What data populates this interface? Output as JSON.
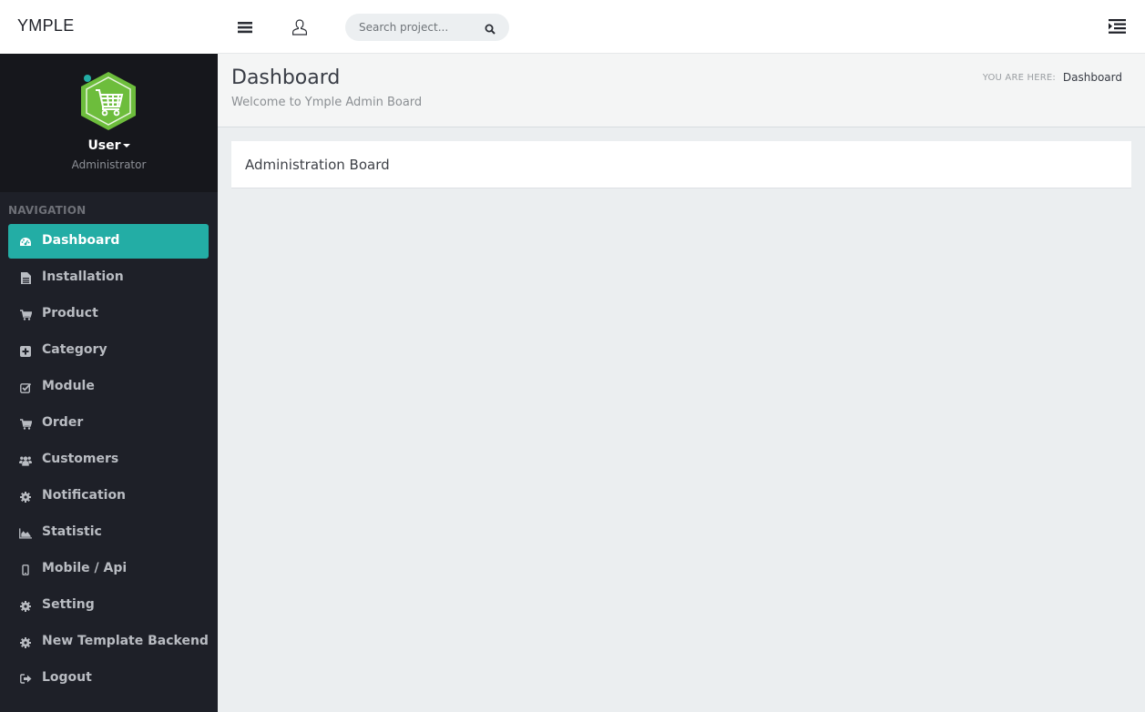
{
  "brand": {
    "name": "YMPLE"
  },
  "topbar": {
    "menu_icon": "bars-icon",
    "user_icon": "user-outline-icon",
    "search": {
      "placeholder": "Search project...",
      "value": "",
      "icon": "search-icon"
    },
    "right_toggle_icon": "indent-icon"
  },
  "profile": {
    "name": "User",
    "role": "Administrator",
    "status": "online",
    "avatar_icon": "shopping-cart-hexagon-logo"
  },
  "sidebar": {
    "section_title": "NAVIGATION",
    "items": [
      {
        "label": "Dashboard",
        "icon": "dashboard-icon",
        "active": true
      },
      {
        "label": "Installation",
        "icon": "file-text-icon",
        "active": false
      },
      {
        "label": "Product",
        "icon": "shopping-cart-icon",
        "active": false
      },
      {
        "label": "Category",
        "icon": "plus-square-icon",
        "active": false
      },
      {
        "label": "Module",
        "icon": "check-square-icon",
        "active": false
      },
      {
        "label": "Order",
        "icon": "shopping-cart-icon",
        "active": false
      },
      {
        "label": "Customers",
        "icon": "users-icon",
        "active": false
      },
      {
        "label": "Notification",
        "icon": "cog-icon",
        "active": false
      },
      {
        "label": "Statistic",
        "icon": "area-chart-icon",
        "active": false
      },
      {
        "label": "Mobile / Api",
        "icon": "mobile-icon",
        "active": false
      },
      {
        "label": "Setting",
        "icon": "cog-icon",
        "active": false
      },
      {
        "label": "New Template Backend",
        "icon": "cog-icon",
        "active": false
      },
      {
        "label": "Logout",
        "icon": "sign-out-icon",
        "active": false
      }
    ]
  },
  "header": {
    "title": "Dashboard",
    "subtitle": "Welcome to Ymple Admin Board",
    "breadcrumb_label": "YOU ARE HERE:",
    "breadcrumb_current": "Dashboard"
  },
  "panel": {
    "title": "Administration Board"
  },
  "colors": {
    "accent": "#23ada5",
    "sidebar_bg": "#1e2028",
    "profile_bg": "#16171c",
    "avatar_green": "#6dbd3c",
    "content_bg": "#ebeef0"
  }
}
